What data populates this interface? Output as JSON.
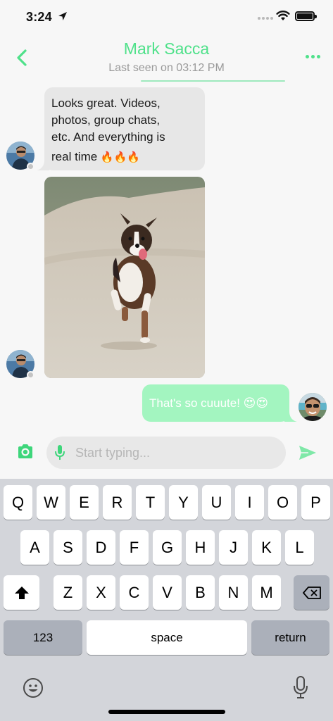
{
  "status_bar": {
    "time": "3:24"
  },
  "header": {
    "contact_name": "Mark Sacca",
    "last_seen": "Last seen on 03:12 PM",
    "accent_color": "#4fe18a"
  },
  "messages": {
    "incoming_text_line1": "Looks great. Videos,",
    "incoming_text_line2": "photos, group chats,",
    "incoming_text_line3": "etc. And everything is",
    "incoming_text_line4": "real time",
    "incoming_emoji": "🔥🔥🔥",
    "incoming_photo": "photo of a dog running on sand",
    "outgoing_text": "That's so cuuute! 😍😍",
    "outgoing_bubble_color": "#a3f5c0",
    "incoming_bubble_color": "#e7e7e7"
  },
  "composer": {
    "placeholder": "Start typing...",
    "camera_icon": "camera-icon",
    "mic_icon": "microphone-icon",
    "send_icon": "send-icon"
  },
  "keyboard": {
    "row1": [
      "Q",
      "W",
      "E",
      "R",
      "T",
      "Y",
      "U",
      "I",
      "O",
      "P"
    ],
    "row2": [
      "A",
      "S",
      "D",
      "F",
      "G",
      "H",
      "J",
      "K",
      "L"
    ],
    "row3": [
      "Z",
      "X",
      "C",
      "V",
      "B",
      "N",
      "M"
    ],
    "numbers_label": "123",
    "space_label": "space",
    "return_label": "return",
    "shift_icon": "shift-icon",
    "backspace_icon": "backspace-icon",
    "emoji_icon": "emoji-icon",
    "dictation_icon": "microphone-icon"
  }
}
